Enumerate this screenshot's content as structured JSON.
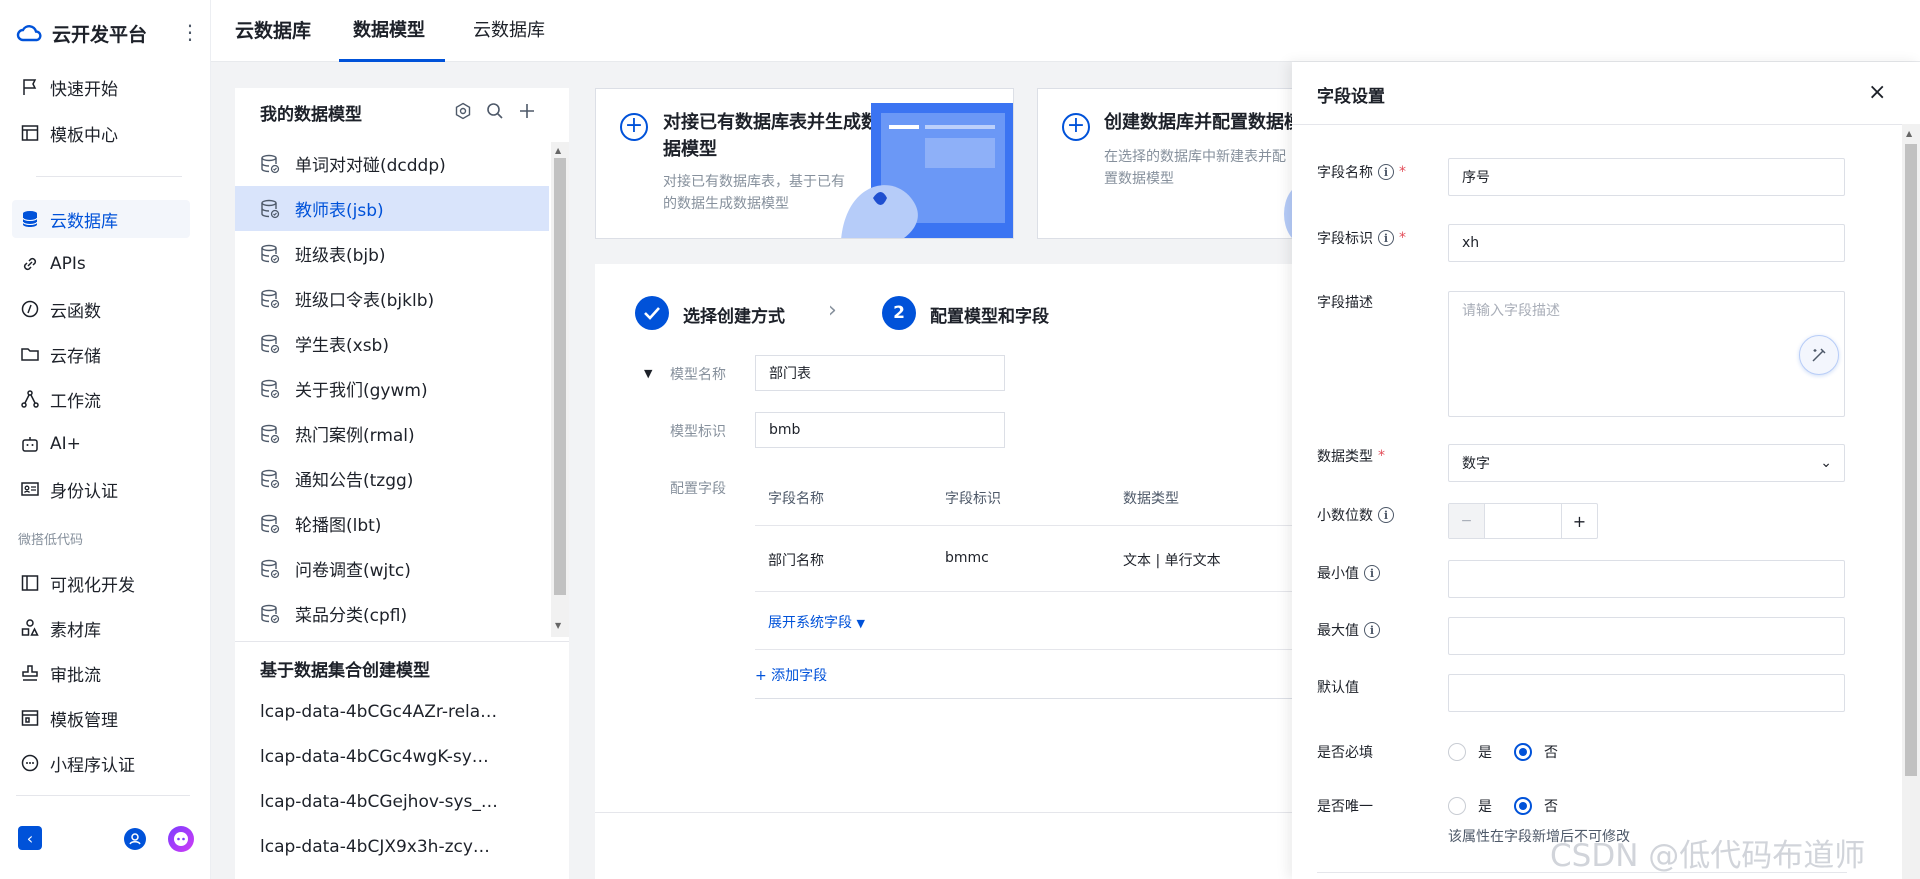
{
  "brand": {
    "name": "云开发平台"
  },
  "sidebar": {
    "items": [
      {
        "label": "快速开始"
      },
      {
        "label": "模板中心"
      },
      {
        "label": "云数据库"
      },
      {
        "label": "APIs"
      },
      {
        "label": "云函数"
      },
      {
        "label": "云存储"
      },
      {
        "label": "工作流"
      },
      {
        "label": "AI+"
      },
      {
        "label": "身份认证"
      },
      {
        "label": "可视化开发"
      },
      {
        "label": "素材库"
      },
      {
        "label": "审批流"
      },
      {
        "label": "模板管理"
      },
      {
        "label": "小程序认证"
      }
    ],
    "section_lowcode": "微搭低代码"
  },
  "topbar": {
    "title": "云数据库",
    "tabs": [
      {
        "label": "数据模型"
      },
      {
        "label": "云数据库"
      }
    ]
  },
  "models_panel": {
    "title": "我的数据模型",
    "items": [
      {
        "label": "单词对对碰(dcddp)"
      },
      {
        "label": "教师表(jsb)"
      },
      {
        "label": "班级表(bjb)"
      },
      {
        "label": "班级口令表(bjklb)"
      },
      {
        "label": "学生表(xsb)"
      },
      {
        "label": "关于我们(gywm)"
      },
      {
        "label": "热门案例(rmal)"
      },
      {
        "label": "通知公告(tzgg)"
      },
      {
        "label": "轮播图(lbt)"
      },
      {
        "label": "问卷调查(wjtc)"
      },
      {
        "label": "菜品分类(cpfl)"
      }
    ],
    "collection_title": "基于数据集合创建模型",
    "collections": [
      {
        "label": "lcap-data-4bCGc4AZr-rela…"
      },
      {
        "label": "lcap-data-4bCGc4wgK-sy…"
      },
      {
        "label": "lcap-data-4bCGejhov-sys_…"
      },
      {
        "label": "lcap-data-4bCJX9x3h-zcy…"
      }
    ]
  },
  "cards": [
    {
      "title_line1": "对接已有数据库表并生成数",
      "title_line2": "据模型",
      "desc_line1": "对接已有数据库表，基于已有",
      "desc_line2": "的数据生成数据模型"
    },
    {
      "title_line1": "创建数据库并配置数据模",
      "desc_line1": "在选择的数据库中新建表并配",
      "desc_line2": "置数据模型"
    }
  ],
  "steps": {
    "step1": "选择创建方式",
    "step2_num": "2",
    "step2": "配置模型和字段"
  },
  "form": {
    "model_name_label": "模型名称",
    "model_name_value": "部门表",
    "model_id_label": "模型标识",
    "model_id_value": "bmb",
    "config_fields_label": "配置字段",
    "table_headers": [
      "字段名称",
      "字段标识",
      "数据类型"
    ],
    "row": {
      "name": "部门名称",
      "id": "bmmc",
      "type": "文本 | 单行文本"
    },
    "expand_system": "展开系统字段",
    "add_field": "+ 添加字段"
  },
  "drawer": {
    "title": "字段设置",
    "field_name_label": "字段名称",
    "field_name_value": "序号",
    "field_id_label": "字段标识",
    "field_id_value": "xh",
    "desc_label": "字段描述",
    "desc_placeholder": "请输入字段描述",
    "data_type_label": "数据类型",
    "data_type_value": "数字",
    "decimals_label": "小数位数",
    "decimals_minus": "−",
    "decimals_plus": "+",
    "min_label": "最小值",
    "max_label": "最大值",
    "default_label": "默认值",
    "required_label": "是否必填",
    "unique_label": "是否唯一",
    "yes": "是",
    "no": "否",
    "unique_hint": "该属性在字段新增后不可修改"
  },
  "watermark": "CSDN @低代码布道师",
  "colors": {
    "accent": "#0052d9",
    "selected_bg": "#d9e4fb",
    "required": "#e34d59"
  }
}
